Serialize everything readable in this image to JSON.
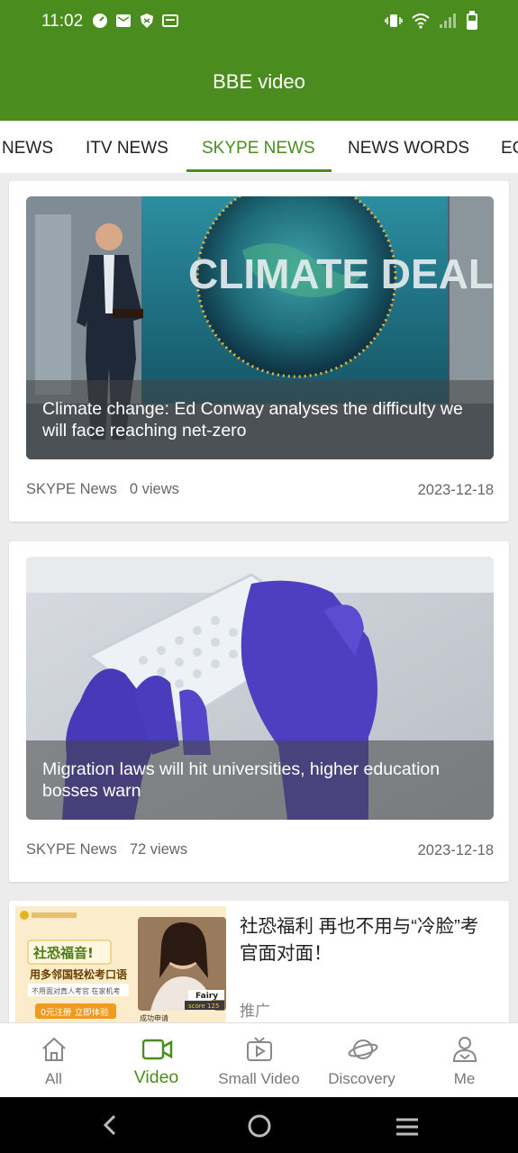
{
  "status_bar": {
    "time": "11:02"
  },
  "header": {
    "title": "BBE video"
  },
  "tabs": [
    {
      "label": "NEWS"
    },
    {
      "label": "ITV NEWS"
    },
    {
      "label": "SKYPE NEWS",
      "active": true
    },
    {
      "label": "NEWS WORDS"
    },
    {
      "label": "EC"
    }
  ],
  "feed": [
    {
      "thumb_text": "CLIMATE DEAL",
      "caption": "Climate change: Ed Conway analyses the difficulty we will face reaching net-zero",
      "source": "SKYPE News",
      "views": "0 views",
      "date": "2023-12-18"
    },
    {
      "caption": "Migration laws will hit universities, higher education bosses warn",
      "source": "SKYPE News",
      "views": "72 views",
      "date": "2023-12-18"
    }
  ],
  "ad": {
    "title": "社恐福利 再也不用与“冷脸”考官面对面！",
    "tag": "推广",
    "image_text": {
      "line1": "社恐福音!",
      "line2": "用多邻国轻松考口语",
      "line3": "不用面对真人考官 在家机考",
      "button": "0元注册 立即体验",
      "name": "Fairy",
      "score": "score 125",
      "footer": "成功申请"
    }
  },
  "bottom_nav": [
    {
      "label": "All",
      "icon": "home-icon"
    },
    {
      "label": "Video",
      "icon": "video-icon",
      "active": true
    },
    {
      "label": "Small Video",
      "icon": "tv-icon"
    },
    {
      "label": "Discovery",
      "icon": "planet-icon"
    },
    {
      "label": "Me",
      "icon": "person-icon"
    }
  ],
  "colors": {
    "brand_green": "#4a8d1e",
    "text_gray": "#666666"
  }
}
